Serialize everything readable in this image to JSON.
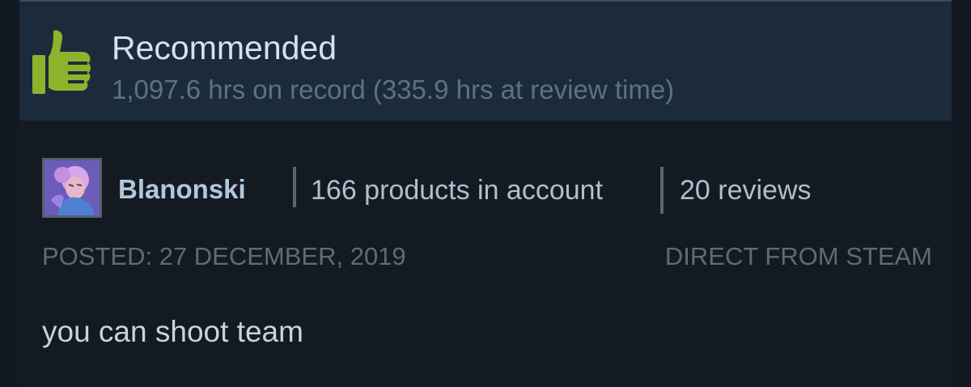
{
  "review": {
    "verdict": "Recommended",
    "hours": "1,097.6 hrs on record (335.9 hrs at review time)",
    "thumb_icon": "thumbs-up-icon",
    "accent_color": "#8fb22c",
    "author": {
      "name": "Blanonski",
      "products": "166 products in account",
      "reviews": "20 reviews",
      "avatar": "user-avatar"
    },
    "posted": "POSTED: 27 DECEMBER, 2019",
    "source": "DIRECT FROM STEAM",
    "body": "you can shoot team"
  }
}
